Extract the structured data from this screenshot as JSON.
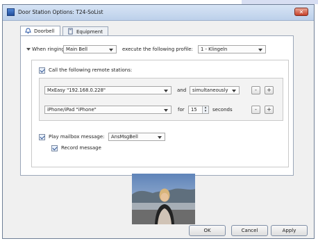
{
  "window": {
    "title": "Door Station Options: T24-SoList",
    "close_glyph": "✕",
    "icon": "app-icon"
  },
  "tabs": [
    {
      "label": "Doorbell",
      "icon": "doorbell-icon",
      "active": true
    },
    {
      "label": "Equipment",
      "icon": "equipment-icon",
      "active": false
    }
  ],
  "doorbell": {
    "when_ringing_label": "When ringing:",
    "ring_select_value": "Main Bell",
    "execute_label": "execute the following profile:",
    "profile_select_value": "1 - Klingeln",
    "call_checkbox_label": "Call the following remote stations:",
    "call_checked": true,
    "stations": [
      {
        "station": "MxEasy \"192.168.0.228\"",
        "connector": "and",
        "mode_value": "simultaneously"
      },
      {
        "station": "iPhone/iPad \"iPhone\"",
        "connector": "for",
        "seconds_value": "15",
        "seconds_label": "seconds"
      }
    ],
    "minus_label": "-",
    "plus_label": "+",
    "mailbox_checkbox_label": "Play mailbox message:",
    "mailbox_checked": true,
    "mailbox_select_value": "AnsMsgBell",
    "record_checkbox_label": "Record message",
    "record_checked": true
  },
  "buttons": {
    "ok": "OK",
    "cancel": "Cancel",
    "apply": "Apply"
  },
  "colors": {
    "titlebar": "#bcd0ea",
    "close": "#c7412a",
    "panel_bg": "#ffffff",
    "window_bg": "#f0f0f0"
  }
}
